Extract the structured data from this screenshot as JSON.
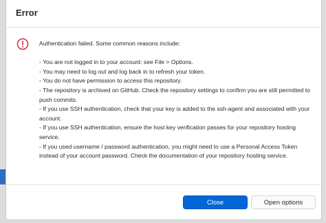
{
  "dialog": {
    "title": "Error",
    "icon": "error-circle-icon",
    "accent_color": "#d73a49",
    "message_intro": "Authentication failed. Some common reasons include:",
    "reasons": [
      "- You are not logged in to your account: see File > Options.",
      "- You may need to log out and log back in to refresh your token.",
      "- You do not have permission to access this repository.",
      "- The repository is archived on GitHub. Check the repository settings to confirm you are still permitted to push commits.",
      "- If you use SSH authentication, check that your key is added to the ssh-agent and associated with your account.",
      "- If you use SSH authentication, ensure the host key verification passes for your repository hosting service.",
      "- If you used username / password authentication, you might need to use a Personal Access Token instead of your account password. Check the documentation of your repository hosting service."
    ]
  },
  "buttons": {
    "close_label": "Close",
    "open_options_label": "Open options",
    "primary_color": "#0366d6"
  }
}
